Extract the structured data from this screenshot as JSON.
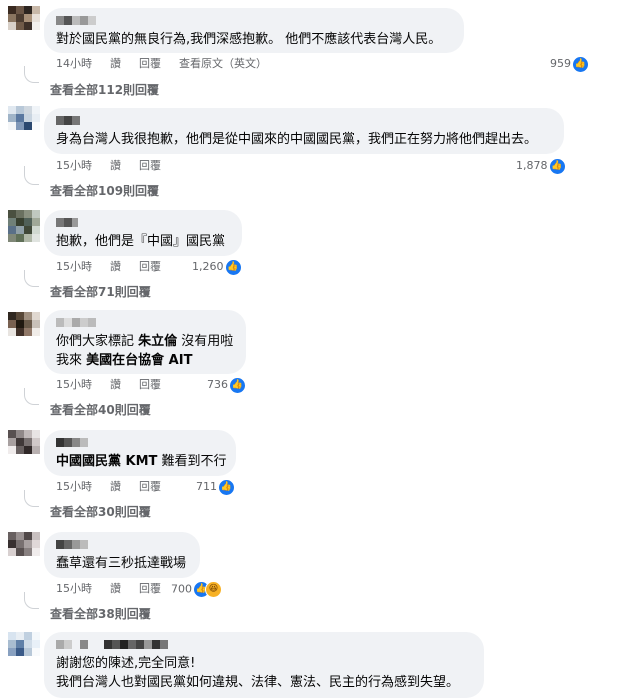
{
  "comments": [
    {
      "text": "對於國民黨的無良行為,我們深感抱歉。 他們不應該代表台灣人民。",
      "time": "14小時",
      "like": "讚",
      "reply": "回覆",
      "translate": "查看原文（英文）",
      "reactions": "959",
      "view_replies": "查看全部112則回覆"
    },
    {
      "text": "身為台灣人我很抱歉，他們是從中國來的中國國民黨，我們正在努力將他們趕出去。",
      "time": "15小時",
      "like": "讚",
      "reply": "回覆",
      "reactions": "1,878",
      "view_replies": "查看全部109則回覆"
    },
    {
      "text": "抱歉，他們是『中國』國民黨",
      "time": "15小時",
      "like": "讚",
      "reply": "回覆",
      "reactions": "1,260",
      "view_replies": "查看全部71則回覆"
    },
    {
      "line1_prefix": "你們大家標記 ",
      "line1_tag": "朱立倫",
      "line1_suffix": " 沒有用啦",
      "line2_prefix": "我來 ",
      "line2_tag": "美國在台協會 AIT",
      "time": "15小時",
      "like": "讚",
      "reply": "回覆",
      "reactions": "736",
      "view_replies": "查看全部40則回覆"
    },
    {
      "tag": "中國國民黨 KMT",
      "suffix": " 難看到不行",
      "time": "15小時",
      "like": "讚",
      "reply": "回覆",
      "reactions": "711",
      "view_replies": "查看全部30則回覆"
    },
    {
      "text": "蠢草還有三秒抵達戰場",
      "time": "15小時",
      "like": "讚",
      "reply": "回覆",
      "reactions": "700",
      "view_replies": "查看全部38則回覆"
    },
    {
      "line1": "謝謝您的陳述,完全同意!",
      "line2": "我們台灣人也對國民黨如何違規、法律、憲法、民主的行為感到失望。"
    }
  ],
  "icons": {
    "like": "like-icon",
    "haha": "haha-icon"
  },
  "colors": {
    "bubble": "#f0f2f5",
    "like_blue": "#1877f2",
    "meta_gray": "#65676b"
  }
}
